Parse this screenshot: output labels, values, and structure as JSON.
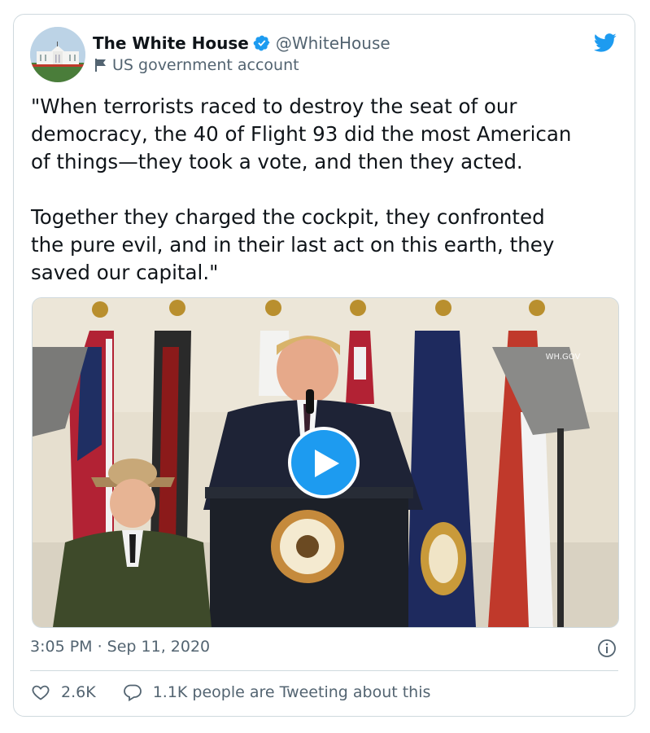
{
  "author": {
    "name": "The White House",
    "handle": "@WhiteHouse",
    "label": "US government account"
  },
  "tweet": {
    "paragraph1_lines": [
      "\"When terrorists raced to destroy the seat of our",
      "democracy, the 40 of Flight 93 did the most American",
      "of things—they took a vote, and then they acted."
    ],
    "paragraph2_lines": [
      "Together they charged the cockpit, they confronted",
      "the pure evil, and in their last act on this earth, they",
      "saved our capital.\""
    ]
  },
  "media": {
    "watermark": "WH.GOV",
    "seal_text": "SEAL OF THE PRESIDENT OF THE UNITED STATES"
  },
  "timestamp": "3:05 PM · Sep 11, 2020",
  "actions": {
    "likes": "2.6K",
    "conversation": "1.1K people are Tweeting about this"
  },
  "colors": {
    "twitter_blue": "#1d9bf0",
    "secondary_text": "#536471",
    "primary_text": "#0f1419",
    "border": "#cfd9de"
  },
  "icons": [
    "verified-badge-icon",
    "government-flag-icon",
    "twitter-bird-icon",
    "play-icon",
    "info-icon",
    "heart-icon",
    "reply-bubble-icon"
  ]
}
